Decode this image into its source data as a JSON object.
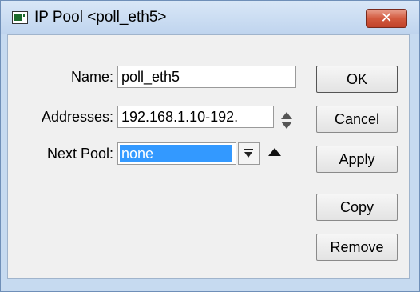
{
  "window": {
    "title": "IP Pool <poll_eth5>",
    "icon": "app-window-icon",
    "close_label": "✕"
  },
  "form": {
    "name": {
      "label": "Name:",
      "value": "poll_eth5"
    },
    "addresses": {
      "label": "Addresses:",
      "value": "192.168.1.10-192."
    },
    "next_pool": {
      "label": "Next Pool:",
      "value": "none"
    }
  },
  "buttons": {
    "ok": "OK",
    "cancel": "Cancel",
    "apply": "Apply",
    "copy": "Copy",
    "remove": "Remove"
  },
  "colors": {
    "selection": "#3399ff",
    "close_button": "#c94a31",
    "window_frame": "#c6daf0"
  }
}
